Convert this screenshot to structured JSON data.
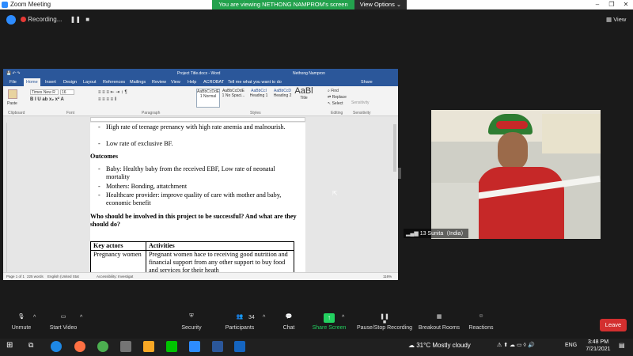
{
  "zoom": {
    "title": "Zoom Meeting",
    "viewing_banner": "You are viewing NETHONG NAMPROM's screen",
    "view_options": "View Options",
    "recording_label": "Recording...",
    "view_label": "View"
  },
  "word": {
    "doc_title": "Project Title.docx - Word",
    "user_name": "Nethong Nampron",
    "share_label": "Share",
    "tabs": [
      "File",
      "Home",
      "Insert",
      "Design",
      "Layout",
      "References",
      "Mailings",
      "Review",
      "View",
      "Help",
      "ACROBAT",
      "Tell me what you want to do"
    ],
    "ribbon": {
      "paste": "Paste",
      "font_name": "Times New R",
      "font_size": "16",
      "styles": [
        "AaBbCcDdE",
        "AaBbCcDdE",
        "AaBbCcI",
        "AaBbCcD",
        "AaBl"
      ],
      "style_names": [
        "1 Normal",
        "1 No Spaci...",
        "Heading 1",
        "Heading 2",
        "Title"
      ],
      "find": "Find",
      "replace": "Replace",
      "select": "Select",
      "sensitivity": "Sensitivity",
      "groups": [
        "Clipboard",
        "Font",
        "Paragraph",
        "Styles",
        "Editing",
        "Sensitivity"
      ]
    },
    "page": {
      "bullets_top": [
        "High rate of teenage prenancy with high rate anemia and malnourish.",
        "Low rate of exclusive BF."
      ],
      "outcomes_heading": "Outcomes",
      "outcomes": [
        "Baby: Healthy baby from the received EBF, Low rate of neonatal mortality",
        "Mothers: Bonding, attatchment",
        "Healthcare provider: improve quality of care with mother and baby, economic benefit"
      ],
      "question": "Who should be involved in this project to be successful? And what are they should do?",
      "table_headers": [
        "Key actors",
        "Activities"
      ],
      "table_rows": [
        [
          "Pregnancy women",
          " Pregnant women hace to receiving good nutrition and financial support from any other support to buy food and services for their heath"
        ]
      ]
    },
    "status": {
      "page": "Page 1 of 1",
      "words": "225 words",
      "language": "English (United Stat",
      "accessibility": "Accessibility: Investigat",
      "zoom": "116%"
    }
  },
  "video": {
    "participant_label": "13 Sunita（India）"
  },
  "toolbar": {
    "unmute": "Unmute",
    "start_video": "Start Video",
    "security": "Security",
    "participants": "Participants",
    "participants_count": "34",
    "chat": "Chat",
    "share_screen": "Share Screen",
    "record": "Pause/Stop Recording",
    "breakout": "Breakout Rooms",
    "reactions": "Reactions",
    "leave": "Leave"
  },
  "taskbar": {
    "weather": "31°C  Mostly cloudy",
    "lang": "ENG",
    "time": "3:48 PM",
    "date": "7/21/2021"
  },
  "colors": {
    "zoom_green": "#23a24d",
    "word_blue": "#2b579a",
    "leave_red": "#d32f2f",
    "share_green": "#23d160"
  }
}
